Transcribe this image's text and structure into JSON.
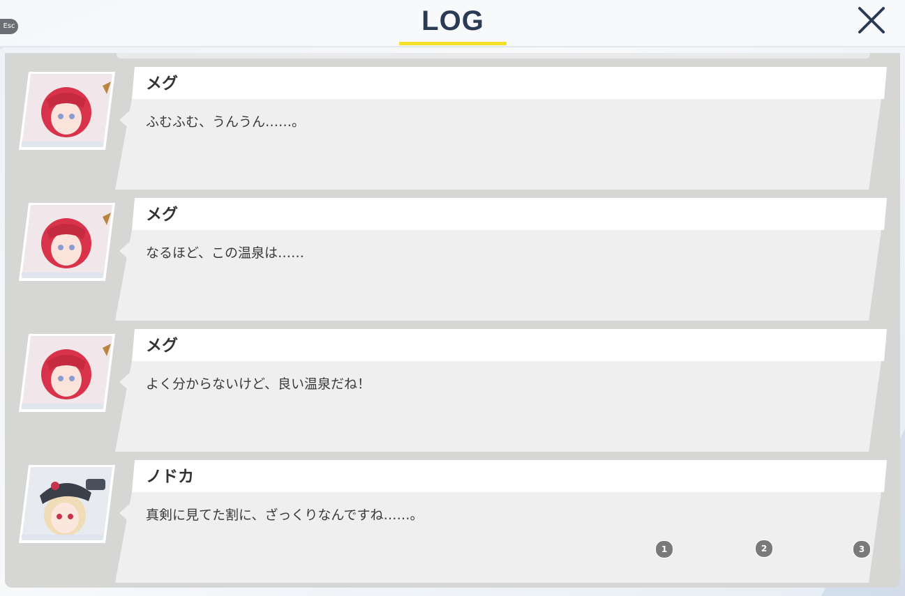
{
  "header": {
    "esc_label": "Esc",
    "title": "LOG",
    "close_icon": "close-icon"
  },
  "entries": [
    {
      "speaker": "メグ",
      "text": "ふむふむ、うんうん……。",
      "portrait": "meg-portrait"
    },
    {
      "speaker": "メグ",
      "text": "なるほど、この温泉は……",
      "portrait": "meg-portrait"
    },
    {
      "speaker": "メグ",
      "text": "よく分からないけど、良い温泉だね！",
      "portrait": "meg-portrait"
    },
    {
      "speaker": "ノドカ",
      "text": "真剣に見てた割に、ざっくりなんですね……。",
      "portrait": "nodoka-portrait"
    }
  ],
  "page_buttons": [
    "1",
    "2",
    "3"
  ],
  "colors": {
    "title_text": "#2b3a55",
    "title_underline": "#f4e22a",
    "panel_bg": "#d6d6d4",
    "bubble_bg": "#efefef",
    "name_tab_bg": "#ffffff",
    "meg_hair": "#d8334a",
    "nodoka_cap": "#3a3f4a"
  }
}
